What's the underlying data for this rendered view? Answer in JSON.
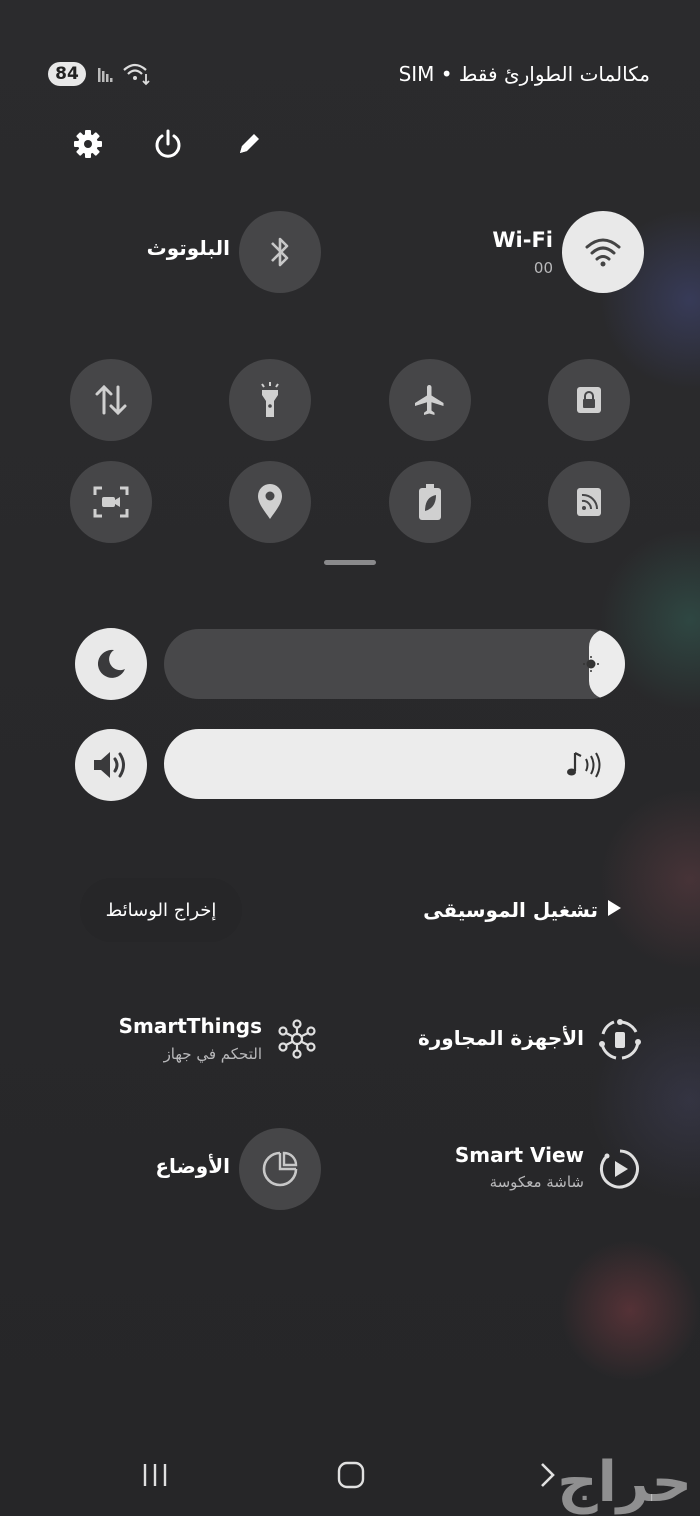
{
  "status_bar": {
    "battery": "84",
    "carrier_text": "مكالمات الطوارئ فقط • SIM"
  },
  "top_actions": {
    "settings_icon": "gear-icon",
    "power_icon": "power-icon",
    "edit_icon": "pencil-icon"
  },
  "wifi": {
    "label": "Wi-Fi",
    "network": "00",
    "icon": "wifi-icon"
  },
  "bluetooth": {
    "label": "البلوتوث",
    "icon": "bluetooth-icon"
  },
  "quick_tiles": [
    {
      "icon": "lock-screen-icon"
    },
    {
      "icon": "airplane-icon"
    },
    {
      "icon": "flashlight-icon"
    },
    {
      "icon": "data-transfer-icon"
    },
    {
      "icon": "cast-icon"
    },
    {
      "icon": "power-saving-icon"
    },
    {
      "icon": "location-icon"
    },
    {
      "icon": "screen-recorder-icon"
    }
  ],
  "brightness": {
    "level": 0.0,
    "icon": "moon-icon"
  },
  "volume": {
    "level": 1.0,
    "icon": "speaker-icon"
  },
  "media": {
    "play_music": "تشغيل الموسيقى",
    "media_output": "إخراج الوسائط"
  },
  "devices": {
    "nearby": {
      "label": "الأجهزة المجاورة",
      "icon": "nearby-devices-icon"
    },
    "smartthings": {
      "label": "SmartThings",
      "sub": "التحكم في جهاز",
      "icon": "smartthings-icon"
    },
    "smart_view": {
      "label": "Smart View",
      "sub": "شاشة معكوسة",
      "icon": "smart-view-icon"
    },
    "modes": {
      "label": "الأوضاع",
      "icon": "modes-icon"
    }
  },
  "nav_bar": {
    "recents_icon": "recents-icon",
    "home_icon": "home-icon",
    "back_icon": "back-icon"
  },
  "watermark": "حراج"
}
